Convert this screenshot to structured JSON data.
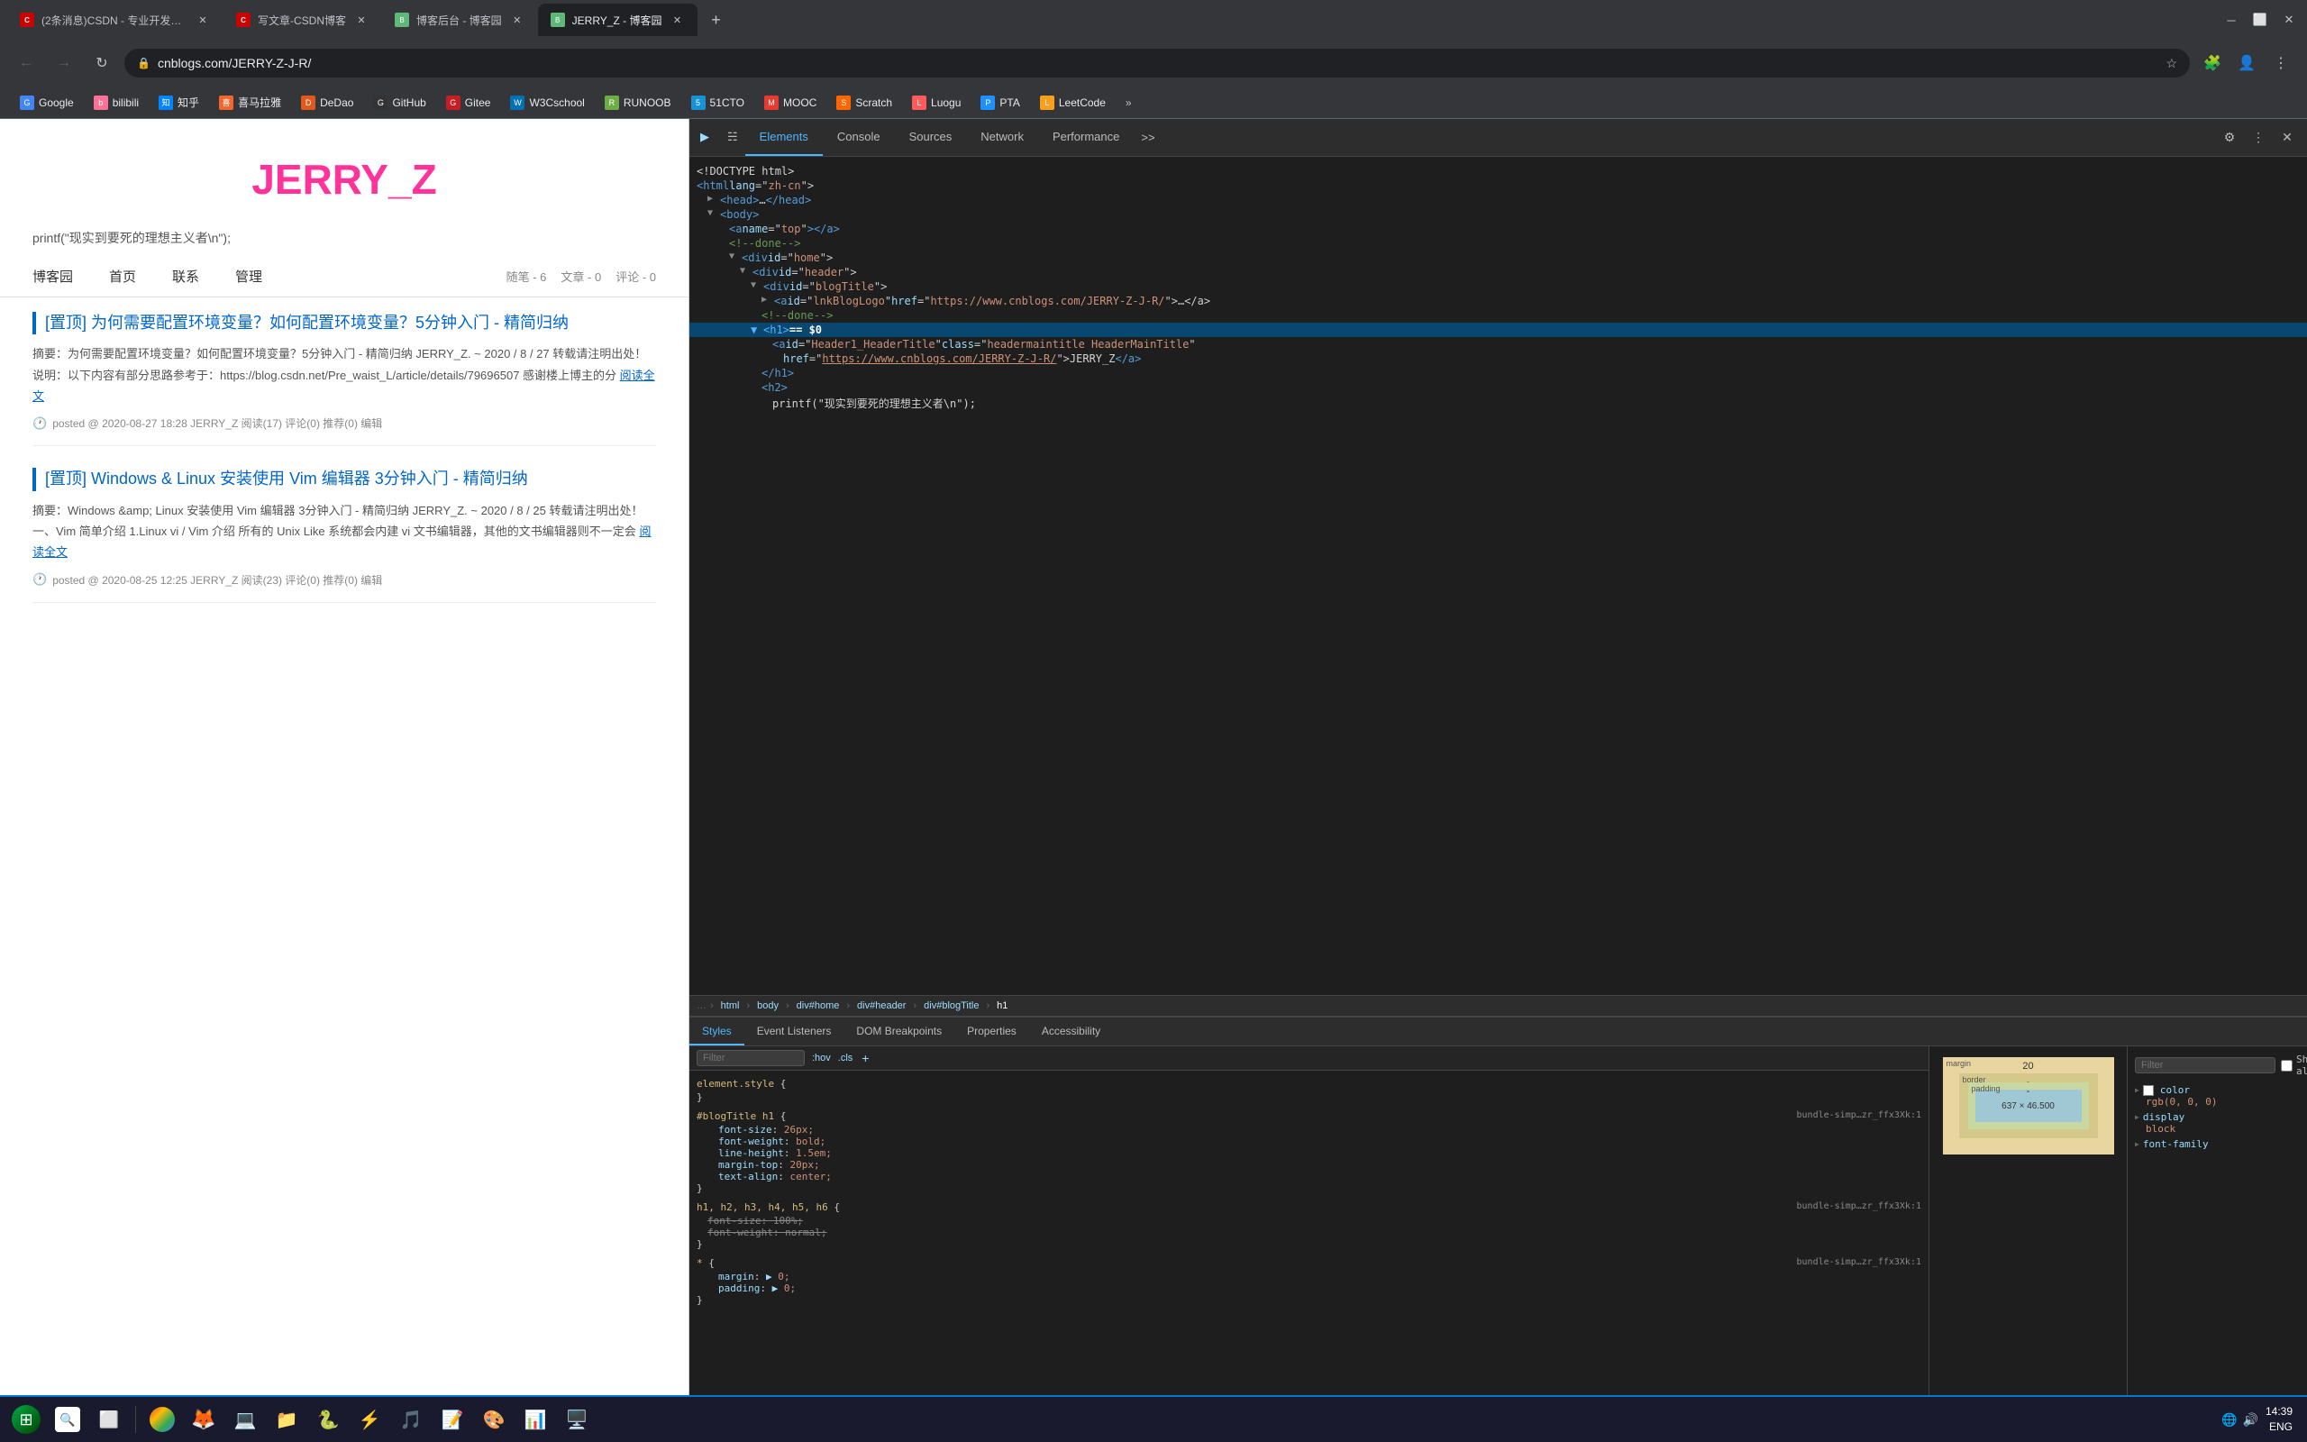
{
  "browser": {
    "tabs": [
      {
        "id": "tab1",
        "favicon_class": "csdn",
        "favicon_text": "C",
        "label": "(2条消息)CSDN - 专业开发者社...",
        "active": false,
        "color": "#c00"
      },
      {
        "id": "tab2",
        "favicon_class": "csdn",
        "favicon_text": "C",
        "label": "写文章-CSDN博客",
        "active": false,
        "color": "#c00"
      },
      {
        "id": "tab3",
        "favicon_class": "cnblogs",
        "favicon_text": "B",
        "label": "博客后台 - 博客园",
        "active": false,
        "color": "#5fb878"
      },
      {
        "id": "tab4",
        "favicon_class": "cnblogs",
        "favicon_text": "B",
        "label": "JERRY_Z - 博客园",
        "active": true,
        "color": "#5fb878"
      }
    ],
    "address": "cnblogs.com/JERRY-Z-J-R/",
    "window_controls": [
      "minimize",
      "maximize",
      "close"
    ]
  },
  "bookmarks": [
    {
      "name": "Google",
      "class": "bm-google",
      "text": "G"
    },
    {
      "name": "bilibili",
      "class": "bm-bili",
      "text": "b"
    },
    {
      "name": "知乎",
      "class": "bm-zhihu",
      "text": "知"
    },
    {
      "name": "喜马拉雅",
      "class": "bm-ximalaya",
      "text": "喜"
    },
    {
      "name": "DeDao",
      "class": "bm-dedao",
      "text": "D"
    },
    {
      "name": "GitHub",
      "class": "bm-github",
      "text": "G"
    },
    {
      "name": "Gitee",
      "class": "bm-gitee",
      "text": "G"
    },
    {
      "name": "W3Cschool",
      "class": "bm-w3c",
      "text": "W"
    },
    {
      "name": "RUNOOB",
      "class": "bm-runoob",
      "text": "R"
    },
    {
      "name": "51CTO",
      "class": "bm-51cto",
      "text": "5"
    },
    {
      "name": "MOOC",
      "class": "bm-mooc",
      "text": "M"
    },
    {
      "name": "Scratch",
      "class": "bm-scratch",
      "text": "S"
    },
    {
      "name": "Luogu",
      "class": "bm-luogu",
      "text": "L"
    },
    {
      "name": "PTA",
      "class": "bm-pta",
      "text": "P"
    },
    {
      "name": "LeetCode",
      "class": "bm-leet",
      "text": "L"
    }
  ],
  "blog": {
    "title": "JERRY_Z",
    "subtitle": "printf(\"现实到要死的理想主义者\\n\");",
    "nav_links": [
      "博客园",
      "首页",
      "联系",
      "管理"
    ],
    "stats": [
      "随笔 - 6",
      "文章 - 0",
      "评论 - 0"
    ],
    "posts": [
      {
        "title": "[置顶] 为何需要配置环境变量？如何配置环境变量？5分钟入门 - 精简归纳",
        "summary": "摘要：为何需要配置环境变量？如何配置环境变量？5分钟入门 - 精简归纳 JERRY_Z. ~ 2020 / 8 / 27 转载请注明出处！ 说明：以下内容有部分思路参考于：https://blog.csdn.net/Pre_waist_L/article/details/79696507 感谢楼上博主的分",
        "read_more": "阅读全文",
        "meta": "posted @ 2020-08-27 18:28 JERRY_Z 阅读(17) 评论(0) 推荐(0) 编辑"
      },
      {
        "title": "[置顶] Windows & Linux 安装使用 Vim 编辑器 3分钟入门 - 精简归纳",
        "summary": "摘要：Windows &amp; Linux 安装使用 Vim 编辑器 3分钟入门 - 精简归纳 JERRY_Z. ~ 2020 / 8 / 25 转载请注明出处！ 一、Vim 简单介绍 1.Linux vi / Vim 介绍 所有的 Unix Like 系统都会内建 vi 文书编辑器，其他的文书编辑器则不一定会",
        "read_more": "阅读全文",
        "meta": "posted @ 2020-08-25 12:25 JERRY_Z 阅读(23) 评论(0) 推荐(0) 编辑"
      }
    ]
  },
  "devtools": {
    "tabs": [
      "Elements",
      "Console",
      "Sources",
      "Network",
      "Performance"
    ],
    "dom_lines": [
      {
        "indent": 0,
        "content": "<!DOCTYPE html>",
        "type": "text",
        "selected": false
      },
      {
        "indent": 0,
        "content": "<html lang=\"zh-cn\">",
        "type": "tag",
        "selected": false
      },
      {
        "indent": 1,
        "content": "▶ <head>…</head>",
        "type": "tag",
        "selected": false
      },
      {
        "indent": 1,
        "content": "▼ <body>",
        "type": "tag",
        "selected": false
      },
      {
        "indent": 2,
        "content": "<a name=\"top\"></a>",
        "type": "tag",
        "selected": false
      },
      {
        "indent": 2,
        "content": "<!--done-->",
        "type": "comment",
        "selected": false
      },
      {
        "indent": 2,
        "content": "▼ <div id=\"home\">",
        "type": "tag",
        "selected": false
      },
      {
        "indent": 3,
        "content": "▼ <div id=\"header\">",
        "type": "tag",
        "selected": false
      },
      {
        "indent": 4,
        "content": "▼ <div id=\"blogTitle\">",
        "type": "tag",
        "selected": false
      },
      {
        "indent": 5,
        "content": "▶ <a id=\"lnkBlogLogo\" href=\"https://www.cnblogs.com/JERRY-Z-J-R/\">…</a>",
        "type": "tag",
        "selected": false
      },
      {
        "indent": 5,
        "content": "<!--done-->",
        "type": "comment",
        "selected": false
      },
      {
        "indent": 5,
        "content": "<h1> == $0",
        "type": "tag-selected",
        "selected": true
      },
      {
        "indent": 6,
        "content": "<a id=\"Header1_HeaderTitle\" class=\"headermaintitle HeaderMainTitle\"",
        "type": "tag",
        "selected": false
      },
      {
        "indent": 7,
        "content": "href=\"https://www.cnblogs.com/JERRY-Z-J-R/\">JERRY_Z</a>",
        "type": "tag",
        "selected": false
      },
      {
        "indent": 5,
        "content": "</h1>",
        "type": "tag",
        "selected": false
      },
      {
        "indent": 5,
        "content": "<h2>",
        "type": "tag",
        "selected": false
      },
      {
        "indent": 6,
        "content": "printf(\"现实到要死的理想主义者\\n\");",
        "type": "text",
        "selected": false
      }
    ],
    "breadcrumb": [
      "html",
      "body",
      "div#home",
      "div#header",
      "div#blogTitle",
      "h1"
    ],
    "styles_tabs": [
      "Styles",
      "Event Listeners",
      "DOM Breakpoints",
      "Properties",
      "Accessibility"
    ],
    "styles_rules": [
      {
        "selector": "element.style {",
        "props": [],
        "closing": "}",
        "source": ""
      },
      {
        "selector": "#blogTitle h1 {",
        "props": [
          {
            "name": "font-size:",
            "val": "26px;"
          },
          {
            "name": "font-weight:",
            "val": "bold;"
          },
          {
            "name": "line-height:",
            "val": "1.5em;"
          },
          {
            "name": "margin-top:",
            "val": "20px;"
          },
          {
            "name": "text-align:",
            "val": "center;"
          }
        ],
        "closing": "}",
        "source": "bundle-simp…zr_ffx3Xk:1"
      },
      {
        "selector": "h1, h2, h3, h4, h5, h6 {",
        "props": [
          {
            "name": "font-size:",
            "val": "100%;"
          },
          {
            "name": "font-weight:",
            "val": "normal;"
          }
        ],
        "closing": "}",
        "source": "bundle-simp…zr_ffx3Xk:1"
      },
      {
        "selector": "* {",
        "props": [
          {
            "name": "margin:",
            "val": "▶ 0;"
          },
          {
            "name": "padding:",
            "val": "▶ 0;"
          }
        ],
        "closing": "}",
        "source": "bundle-simp…zr_ffx3Xk:1"
      }
    ],
    "computed": {
      "filter_placeholder": "Filter",
      "show_all_label": "Show all",
      "props": [
        {
          "name": "color",
          "val": "rgb(0, 0, 0)"
        },
        {
          "name": "display",
          "val": "block"
        },
        {
          "name": "font-family",
          "val": ""
        }
      ]
    },
    "box_model": {
      "margin": "20",
      "border": "-",
      "padding": "-",
      "content": "637 × 46.500"
    }
  },
  "taskbar": {
    "time": "14:39",
    "date": "",
    "lang": "ENG"
  }
}
